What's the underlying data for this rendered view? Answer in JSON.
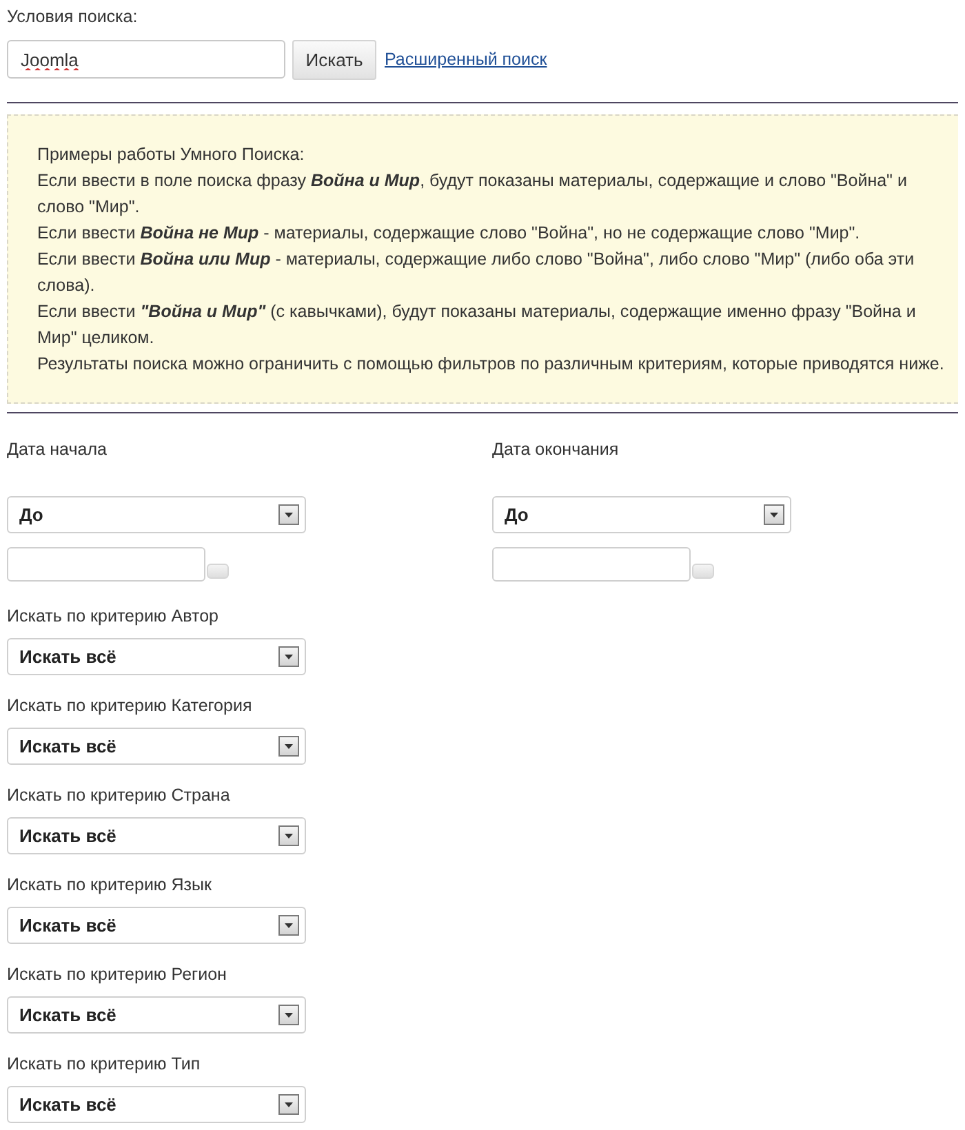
{
  "search": {
    "label": "Условия поиска:",
    "value": "Joomla",
    "misspelled": true,
    "button": "Искать",
    "advanced_link": "Расширенный поиск"
  },
  "info": {
    "lines": [
      "Примеры работы Умного Поиска:",
      "Если ввести в поле поиска фразу **Война и Мир**, будут показаны материалы, содержащие и слово \"Война\" и слово \"Мир\".",
      "Если ввести **Война не Мир** - материалы, содержащие слово \"Война\", но не содержащие слово \"Мир\".",
      "Если ввести **Война или Мир** - материалы, содержащие либо слово \"Война\", либо слово \"Мир\" (либо оба эти слова).",
      "Если ввести **\"Война и Мир\"** (с кавычками), будут показаны материалы, содержащие именно фразу \"Война и Мир\" целиком.",
      "Результаты поиска можно ограничить с помощью фильтров по различным критериям, которые приводятся ниже."
    ]
  },
  "dates": [
    {
      "label": "Дата начала",
      "select": "До"
    },
    {
      "label": "Дата окончания",
      "select": "До"
    }
  ],
  "filters": [
    {
      "label": "Искать по критерию Автор",
      "select": "Искать всё"
    },
    {
      "label": "Искать по критерию Категория",
      "select": "Искать всё"
    },
    {
      "label": "Искать по критерию Страна",
      "select": "Искать всё"
    },
    {
      "label": "Искать по критерию Язык",
      "select": "Искать всё"
    },
    {
      "label": "Искать по критерию Регион",
      "select": "Искать всё"
    },
    {
      "label": "Искать по критерию Тип",
      "select": "Искать всё"
    }
  ]
}
